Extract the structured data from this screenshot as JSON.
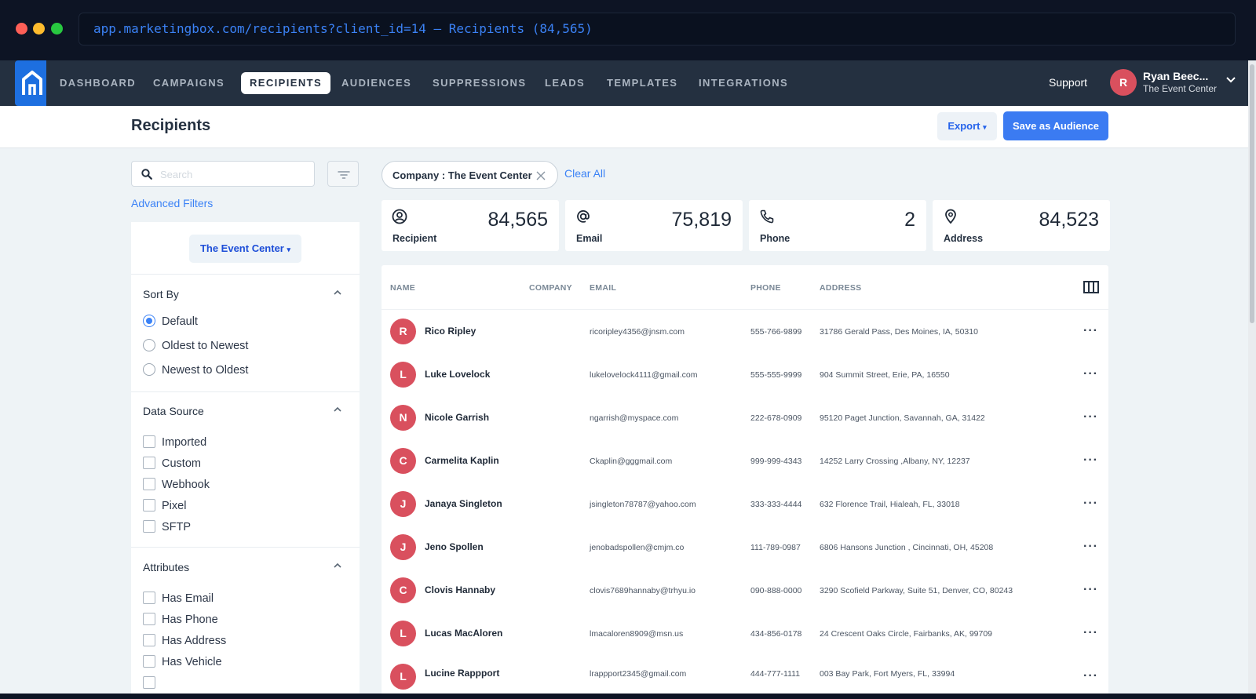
{
  "browser": {
    "url_text": "app.marketingbox.com/recipients?client_id=14 — Recipients (84,565)"
  },
  "nav": {
    "items": [
      {
        "label": "DASHBOARD"
      },
      {
        "label": "CAMPAIGNS"
      },
      {
        "label": "RECIPIENTS"
      },
      {
        "label": "AUDIENCES"
      },
      {
        "label": "SUPPRESSIONS"
      },
      {
        "label": "LEADS"
      },
      {
        "label": "TEMPLATES"
      },
      {
        "label": "INTEGRATIONS"
      }
    ],
    "active": "RECIPIENTS",
    "support": "Support",
    "user": {
      "initial": "R",
      "name": "Ryan Beec...",
      "org": "The Event Center"
    }
  },
  "page": {
    "title": "Recipients",
    "export_label": "Export",
    "save_label": "Save as Audience"
  },
  "sidebar": {
    "search_placeholder": "Search",
    "advanced_filters": "Advanced Filters",
    "client": "The Event Center",
    "sort_by": {
      "title": "Sort By",
      "options": [
        "Default",
        "Oldest to Newest",
        "Newest to Oldest"
      ],
      "selected": "Default"
    },
    "data_source": {
      "title": "Data Source",
      "options": [
        "Imported",
        "Custom",
        "Webhook",
        "Pixel",
        "SFTP"
      ]
    },
    "attributes": {
      "title": "Attributes",
      "options": [
        "Has Email",
        "Has Phone",
        "Has Address",
        "Has Vehicle"
      ]
    }
  },
  "filters": {
    "chip": "Company : The Event Center",
    "clear_all": "Clear All"
  },
  "stats": [
    {
      "label": "Recipient",
      "value": "84,565",
      "icon": "user-circle-icon"
    },
    {
      "label": "Email",
      "value": "75,819",
      "icon": "at-icon"
    },
    {
      "label": "Phone",
      "value": "2",
      "icon": "phone-icon"
    },
    {
      "label": "Address",
      "value": "84,523",
      "icon": "map-pin-icon"
    }
  ],
  "table": {
    "columns": [
      "NAME",
      "COMPANY",
      "EMAIL",
      "PHONE",
      "ADDRESS"
    ],
    "rows": [
      {
        "initial": "R",
        "name": "Rico Ripley",
        "email": "ricoripley4356@jnsm.com",
        "phone": "555-766-9899",
        "address": "31786 Gerald Pass, Des Moines, IA, 50310"
      },
      {
        "initial": "L",
        "name": "Luke Lovelock",
        "email": "lukelovelock4111@gmail.com",
        "phone": "555-555-9999",
        "address": "904 Summit Street, Erie, PA, 16550"
      },
      {
        "initial": "N",
        "name": "Nicole Garrish",
        "email": "ngarrish@myspace.com",
        "phone": "222-678-0909",
        "address": "95120 Paget Junction, Savannah, GA, 31422"
      },
      {
        "initial": "C",
        "name": "Carmelita Kaplin",
        "email": "Ckaplin@gggmail.com",
        "phone": "999-999-4343",
        "address": "14252 Larry Crossing ,Albany, NY, 12237"
      },
      {
        "initial": "J",
        "name": "Janaya Singleton",
        "email": "jsingleton78787@yahoo.com",
        "phone": "333-333-4444",
        "address": "632 Florence Trail, Hialeah, FL, 33018"
      },
      {
        "initial": "J",
        "name": "Jeno Spollen",
        "email": "jenobadspollen@cmjm.co",
        "phone": "111-789-0987",
        "address": "6806 Hansons Junction , Cincinnati, OH, 45208"
      },
      {
        "initial": "C",
        "name": "Clovis Hannaby",
        "email": "clovis7689hannaby@trhyu.io",
        "phone": "090-888-0000",
        "address": "3290 Scofield Parkway, Suite 51, Denver, CO, 80243"
      },
      {
        "initial": "L",
        "name": "Lucas MacAloren",
        "email": "lmacaloren8909@msn.us",
        "phone": "434-856-0178",
        "address": "24 Crescent Oaks Circle, Fairbanks, AK, 99709"
      },
      {
        "initial": "L",
        "name": "Lucine Rappport",
        "email": "lrappport2345@gmail.com",
        "phone": "444-777-1111",
        "address": "003 Bay Park, Fort Myers, FL, 33994"
      }
    ]
  },
  "colors": {
    "nav_bg": "#243040",
    "accent": "#3b7bf2",
    "avatar": "#d9505e",
    "page_bg": "#eef3f6"
  }
}
